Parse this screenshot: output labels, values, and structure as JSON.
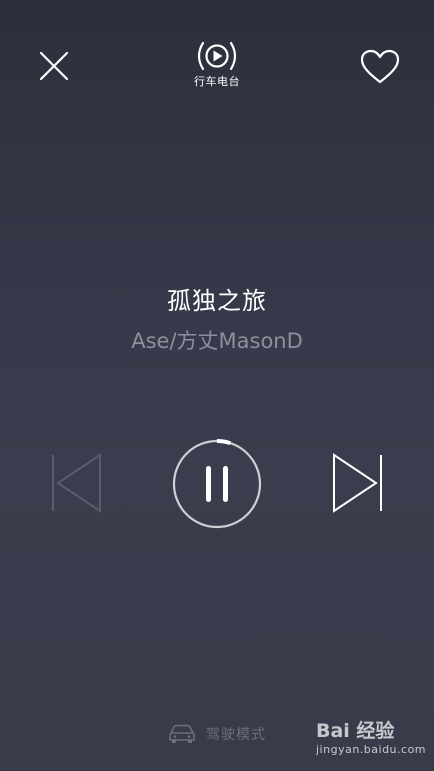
{
  "header": {
    "radio_label": "行车电台"
  },
  "song": {
    "title": "孤独之旅",
    "artist": "Ase/方丈MasonD"
  },
  "player": {
    "state": "playing",
    "progress": 0.05
  },
  "footer": {
    "drive_mode_label": "驾驶模式"
  },
  "watermark": {
    "logo_text": "Bai 经验",
    "url": "jingyan.baidu.com"
  },
  "colors": {
    "background": "#353848",
    "primary": "#ffffff",
    "secondary": "#8d909c",
    "disabled": "#6c6f7c"
  },
  "icons": [
    "close-icon",
    "radio-broadcast-icon",
    "heart-icon",
    "skip-previous-icon",
    "pause-icon",
    "skip-next-icon",
    "car-icon"
  ]
}
